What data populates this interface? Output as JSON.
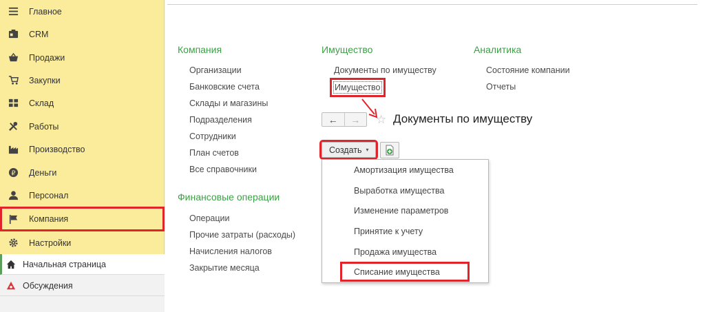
{
  "sidebar": {
    "items": [
      {
        "label": "Главное",
        "icon": "menu-icon"
      },
      {
        "label": "CRM",
        "icon": "crm-icon"
      },
      {
        "label": "Продажи",
        "icon": "basket-icon"
      },
      {
        "label": "Закупки",
        "icon": "cart-icon"
      },
      {
        "label": "Склад",
        "icon": "warehouse-icon"
      },
      {
        "label": "Работы",
        "icon": "tools-icon"
      },
      {
        "label": "Производство",
        "icon": "factory-icon"
      },
      {
        "label": "Деньги",
        "icon": "money-icon"
      },
      {
        "label": "Персонал",
        "icon": "person-icon"
      },
      {
        "label": "Компания",
        "icon": "flag-icon"
      },
      {
        "label": "Настройки",
        "icon": "gear-icon"
      }
    ],
    "bottom": [
      {
        "label": "Начальная страница",
        "icon": "home-icon"
      },
      {
        "label": "Обсуждения",
        "icon": "discussion-icon"
      }
    ]
  },
  "columns": {
    "company": {
      "title": "Компания",
      "links": [
        "Организации",
        "Банковские счета",
        "Склады и магазины",
        "Подразделения",
        "Сотрудники",
        "План счетов",
        "Все справочники"
      ]
    },
    "finops": {
      "title": "Финансовые операции",
      "links": [
        "Операции",
        "Прочие затраты (расходы)",
        "Начисления налогов",
        "Закрытие месяца"
      ]
    },
    "property": {
      "title": "Имущество",
      "links": [
        "Документы по имуществу",
        "Имущество"
      ]
    },
    "analytics": {
      "title": "Аналитика",
      "links": [
        "Состояние компании",
        "Отчеты"
      ]
    }
  },
  "doc": {
    "back_glyph": "←",
    "forward_glyph": "→",
    "star_glyph": "☆",
    "title": "Документы по имуществу",
    "create_label": "Создать",
    "caret_glyph": "▾"
  },
  "dropdown": {
    "items": [
      "Амортизация имущества",
      "Выработка имущества",
      "Изменение параметров",
      "Принятие к учету",
      "Продажа имущества",
      "Списание имущества"
    ]
  },
  "colors": {
    "sidebar_bg": "#fbec9c",
    "accent_green": "#3aa045",
    "highlight_red": "#e0242a"
  }
}
